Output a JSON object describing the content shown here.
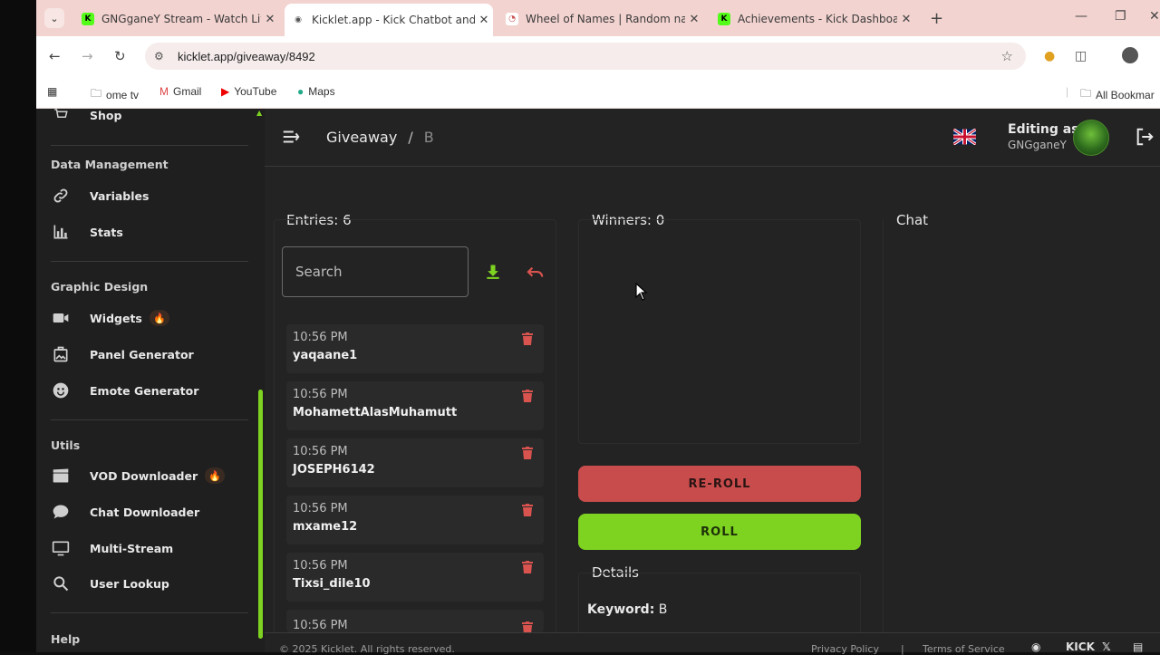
{
  "browser": {
    "tabs": [
      {
        "title": "GNGganeY Stream - Watch Live",
        "favicon_color": "#53fc18",
        "favicon_letter": "K"
      },
      {
        "title": "Kicklet.app - Kick Chatbot and C",
        "favicon_color": "#ffffff",
        "favicon_letter": "◉",
        "active": true
      },
      {
        "title": "Wheel of Names | Random nam",
        "favicon_color": "#ffffff",
        "favicon_letter": "◔"
      },
      {
        "title": "Achievements - Kick Dashboard",
        "favicon_color": "#53fc18",
        "favicon_letter": "K"
      }
    ],
    "url": "kicklet.app/giveaway/8492",
    "bookmarks": [
      "ome tv",
      "Gmail",
      "YouTube",
      "Maps"
    ],
    "all_bookmarks": "All Bookmar"
  },
  "sidebar": {
    "top_partial_item": "Shop",
    "sections": [
      {
        "title": "Data Management",
        "items": [
          "Variables",
          "Stats"
        ]
      },
      {
        "title": "Graphic Design",
        "items": [
          "Widgets",
          "Panel Generator",
          "Emote Generator"
        ]
      },
      {
        "title": "Utils",
        "items": [
          "VOD Downloader",
          "Chat Downloader",
          "Multi-Stream",
          "User Lookup"
        ]
      },
      {
        "title": "Help",
        "items": []
      }
    ],
    "badge_icon": "fire-icon"
  },
  "header": {
    "breadcrumb_root": "Giveaway",
    "breadcrumb_sep": "/",
    "breadcrumb_current": "B",
    "editing_label": "Editing as",
    "editing_user": "GNGganeY"
  },
  "entries": {
    "title": "Entries: 6",
    "search_placeholder": "Search",
    "items": [
      {
        "time": "10:56 PM",
        "name": "yaqaane1"
      },
      {
        "time": "10:56 PM",
        "name": "MohamettAlasMuhamutt"
      },
      {
        "time": "10:56 PM",
        "name": "JOSEPH6142"
      },
      {
        "time": "10:56 PM",
        "name": "mxame12"
      },
      {
        "time": "10:56 PM",
        "name": "Tixsi_dile10"
      }
    ],
    "partial_time": "10:56 PM"
  },
  "winners": {
    "title": "Winners: 0",
    "reroll_label": "RE-ROLL",
    "roll_label": "ROLL"
  },
  "details": {
    "title": "Details",
    "keyword_label": "Keyword:",
    "keyword_value": "B"
  },
  "chat": {
    "title": "Chat"
  },
  "footer": {
    "copyright": "© 2025 Kicklet. All rights reserved.",
    "privacy": "Privacy Policy",
    "divider": "|",
    "terms": "Terms of Service",
    "kick_text": "KICK"
  },
  "colors": {
    "accent": "#7ed321",
    "danger": "#c94c4c",
    "bg": "#232323",
    "sidebar": "#1f1f1f"
  }
}
